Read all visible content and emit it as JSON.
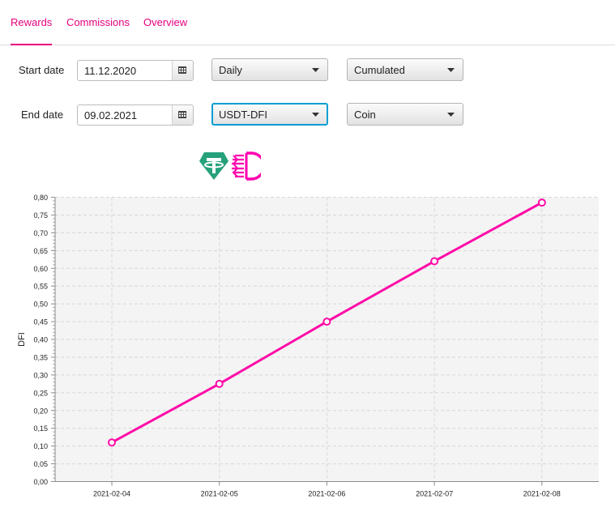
{
  "tabs": [
    {
      "label": "Rewards",
      "active": true
    },
    {
      "label": "Commissions",
      "active": false
    },
    {
      "label": "Overview",
      "active": false
    }
  ],
  "filters": {
    "start_label": "Start date",
    "start_value": "11.12.2020",
    "end_label": "End date",
    "end_value": "09.02.2021",
    "interval": "Daily",
    "mode": "Cumulated",
    "pool": "USDT-DFI",
    "unit": "Coin"
  },
  "icons": {
    "tether": {
      "name": "tether-icon",
      "color": "#26a17b"
    },
    "defichain": {
      "name": "defichain-icon",
      "color": "#ff00af"
    }
  },
  "colors": {
    "accent": "#e6007e",
    "line": "#ff0aa8",
    "focus": "#039ed3",
    "plot_bg": "#f4f4f4"
  },
  "chart_data": {
    "type": "line",
    "title": "",
    "xlabel": "",
    "ylabel": "DFI",
    "categories": [
      "2021-02-04",
      "2021-02-05",
      "2021-02-06",
      "2021-02-07",
      "2021-02-08"
    ],
    "series": [
      {
        "values": [
          0.11,
          0.275,
          0.45,
          0.62,
          0.785
        ]
      }
    ],
    "ylim": [
      0,
      0.8
    ],
    "y_major_step": 0.05,
    "y_minor_step": 0.01,
    "y_tick_labels": [
      "0,00",
      "0,05",
      "0,10",
      "0,15",
      "0,20",
      "0,25",
      "0,30",
      "0,35",
      "0,40",
      "0,45",
      "0,50",
      "0,55",
      "0,60",
      "0,65",
      "0,70",
      "0,75",
      "0,80"
    ],
    "grid": true,
    "legend": "none",
    "markers": "hollow-circle"
  }
}
